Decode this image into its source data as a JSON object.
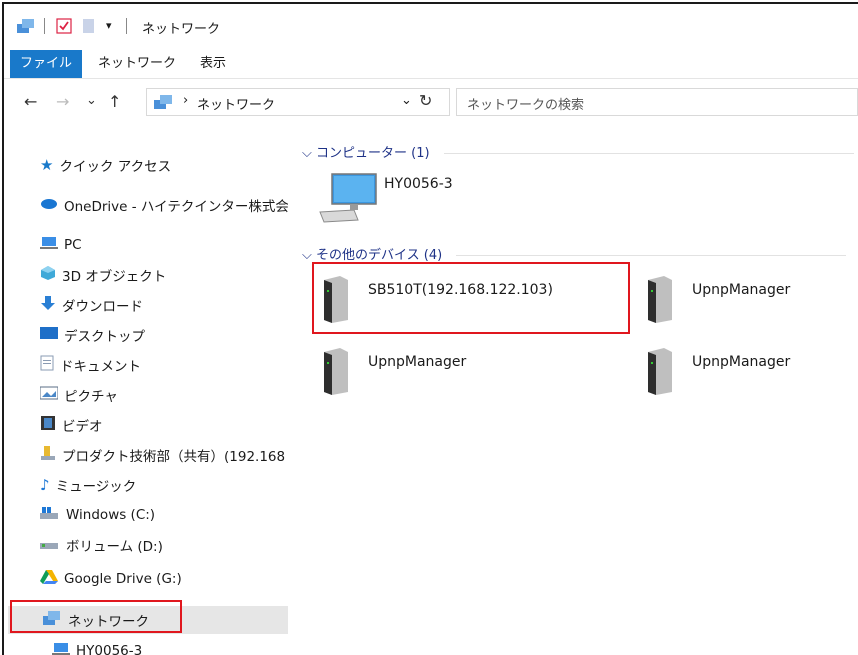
{
  "titlebar": {
    "title": "ネットワーク",
    "qat_dropdown": "▾"
  },
  "ribbon": {
    "tabs": [
      "ファイル",
      "ネットワーク",
      "表示"
    ]
  },
  "navbar": {
    "back": "←",
    "forward": "→",
    "recent": "⌄",
    "up": "↑",
    "path_separator": "›",
    "path": "ネットワーク",
    "dropdown": "⌄",
    "refresh": "↻",
    "search_placeholder": "ネットワークの検索"
  },
  "nav": {
    "quick_access": "クイック アクセス",
    "onedrive": "OneDrive - ハイテクインター株式会社",
    "pc": "PC",
    "objects3d": "3D オブジェクト",
    "downloads": "ダウンロード",
    "desktop": "デスクトップ",
    "documents": "ドキュメント",
    "pictures": "ピクチャ",
    "videos": "ビデオ",
    "shared": "プロダクト技術部（共有）(192.168",
    "music": "ミュージック",
    "windows_c": "Windows (C:)",
    "volume_d": "ボリューム (D:)",
    "gdrive": "Google Drive (G:)",
    "network": "ネットワーク",
    "hy0056": "HY0056-3"
  },
  "content": {
    "computers_header": "コンピューター (1)",
    "computers": [
      {
        "name": "HY0056-3"
      }
    ],
    "other_header": "その他のデバイス (4)",
    "devices": [
      {
        "name": "SB510T(192.168.122.103)"
      },
      {
        "name": "UpnpManager"
      },
      {
        "name": "UpnpManager"
      },
      {
        "name": "UpnpManager"
      }
    ]
  },
  "colors": {
    "accent": "#1979ca",
    "highlight_box": "#e0171e",
    "group_header": "#1e3287"
  }
}
